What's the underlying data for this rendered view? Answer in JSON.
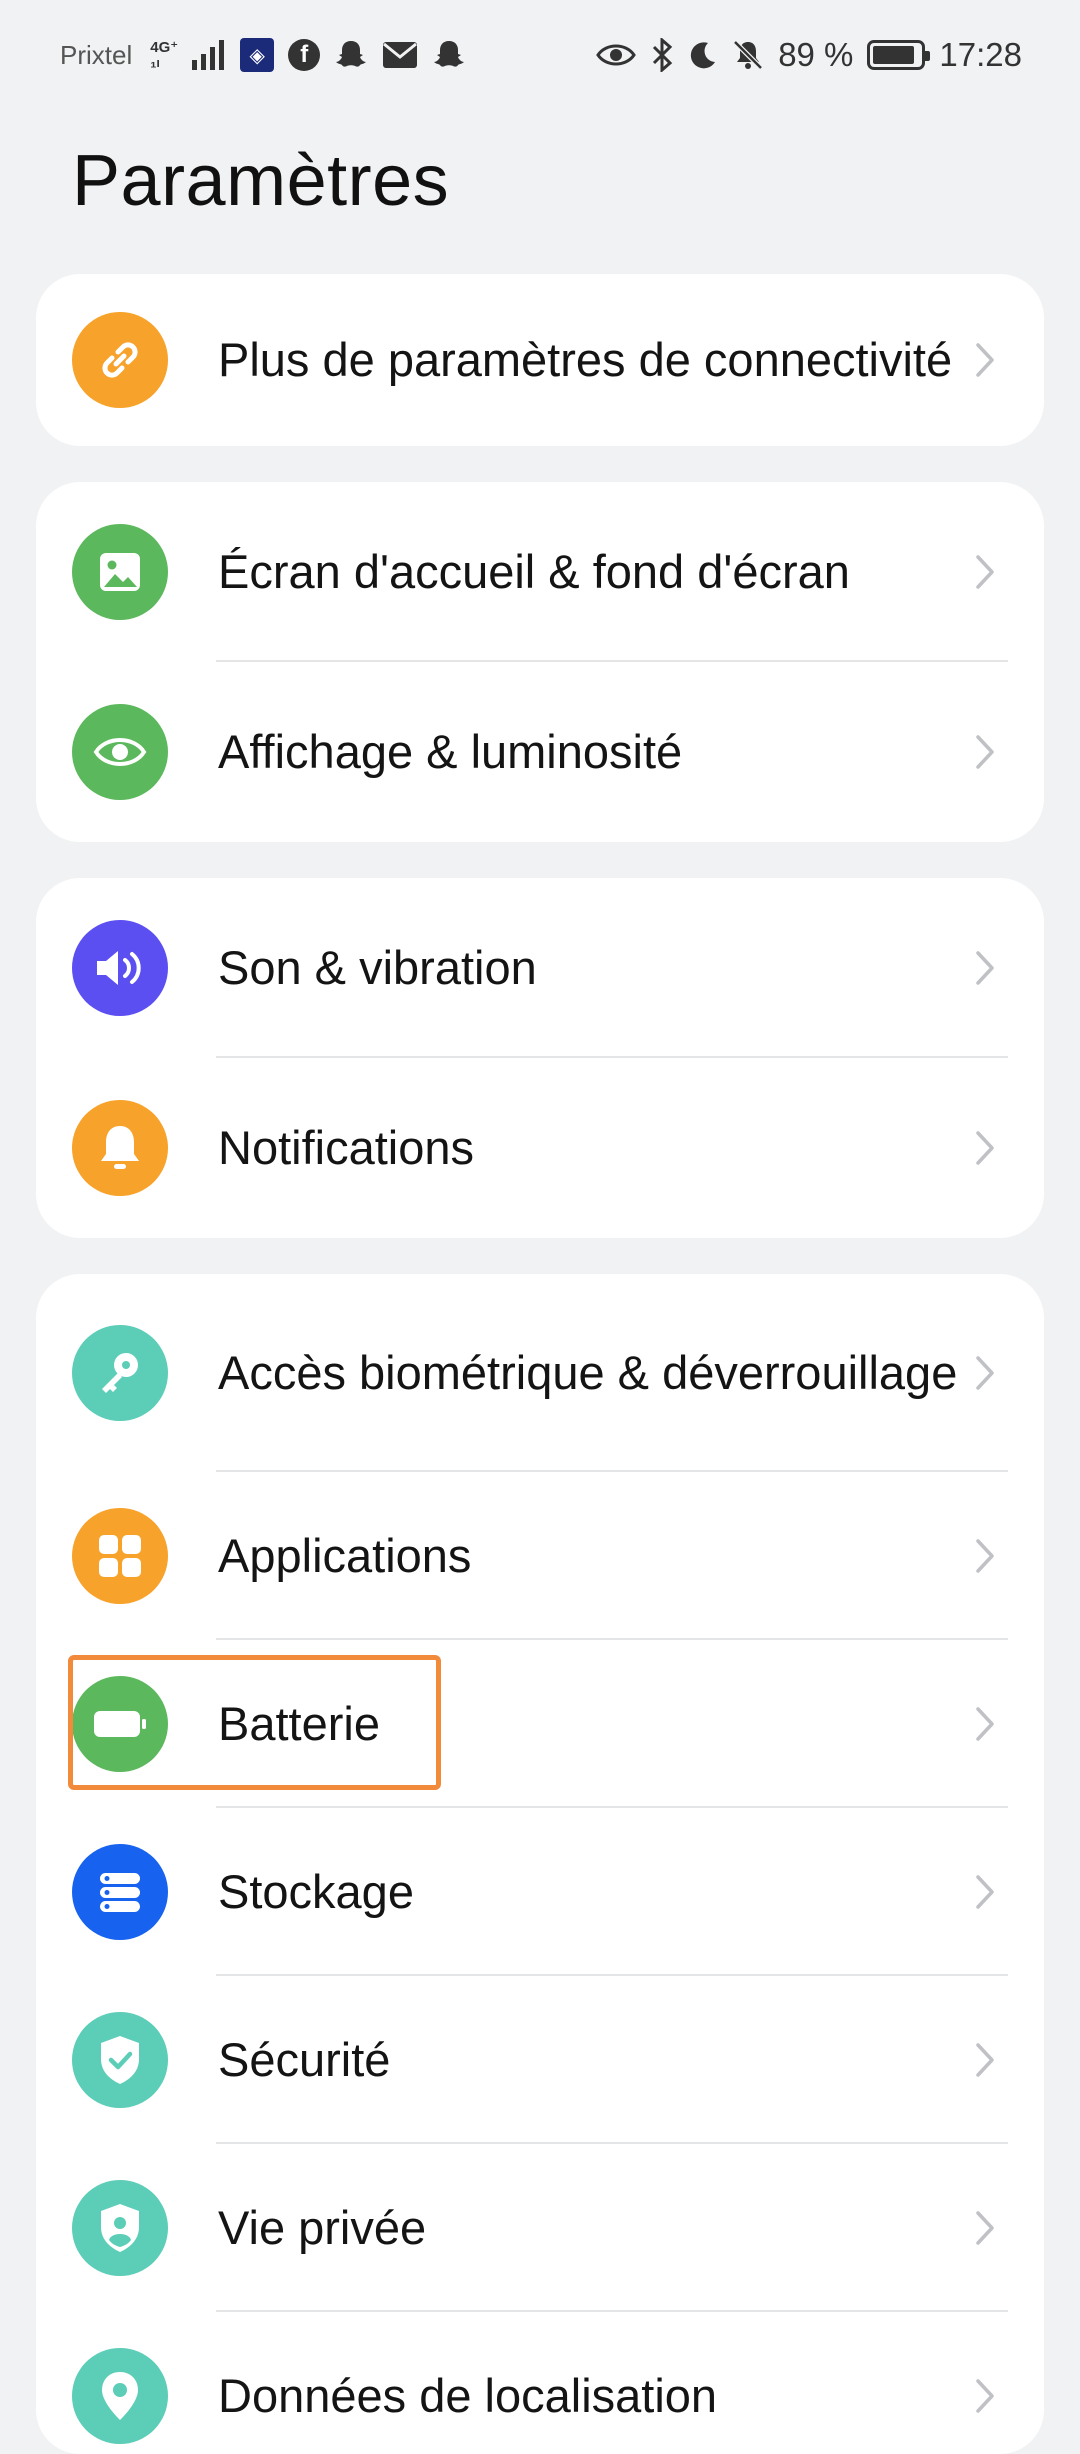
{
  "status_bar": {
    "carrier": "Prixtel",
    "network_top": "4G⁺",
    "network_bottom": "₁ₗ",
    "battery_percent": "89 %",
    "time": "17:28"
  },
  "page": {
    "title": "Paramètres"
  },
  "cards": [
    {
      "items": [
        {
          "label": "Plus de paramètres de connectivité",
          "icon": "link-icon",
          "color": "#f7a22b"
        }
      ]
    },
    {
      "items": [
        {
          "label": "Écran d'accueil & fond d'écran",
          "icon": "image-icon",
          "color": "#5cb85c"
        },
        {
          "label": "Affichage & luminosité",
          "icon": "eye-icon",
          "color": "#5cb85c"
        }
      ]
    },
    {
      "items": [
        {
          "label": "Son & vibration",
          "icon": "speaker-icon",
          "color": "#5b4ff2"
        },
        {
          "label": "Notifications",
          "icon": "bell-icon",
          "color": "#f7a22b"
        }
      ]
    },
    {
      "items": [
        {
          "label": "Accès biométrique & déverrouillage",
          "icon": "key-icon",
          "color": "#5ccdb7"
        },
        {
          "label": "Applications",
          "icon": "apps-icon",
          "color": "#f7a22b"
        },
        {
          "label": "Batterie",
          "icon": "battery-icon",
          "color": "#5cb85c"
        },
        {
          "label": "Stockage",
          "icon": "storage-icon",
          "color": "#1763f0"
        },
        {
          "label": "Sécurité",
          "icon": "shield-check-icon",
          "color": "#5ccdb7"
        },
        {
          "label": "Vie privée",
          "icon": "privacy-shield-icon",
          "color": "#5ccdb7"
        },
        {
          "label": "Données de localisation",
          "icon": "location-icon",
          "color": "#5ccdb7"
        }
      ]
    }
  ]
}
